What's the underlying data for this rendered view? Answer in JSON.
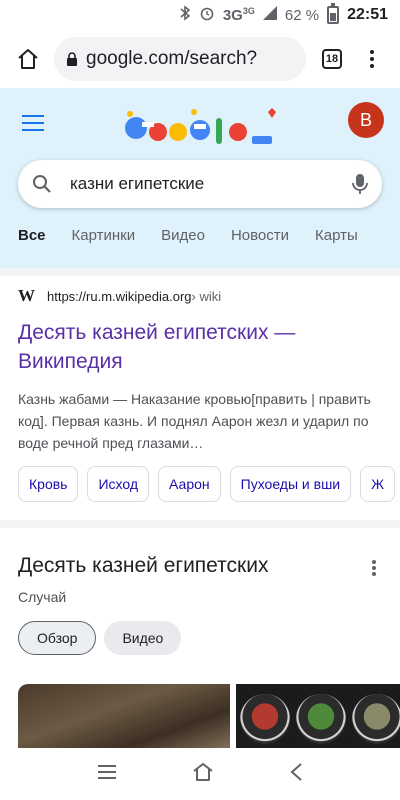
{
  "status_bar": {
    "network": "3G",
    "network_sup": "3G",
    "battery": "62 %",
    "time": "22:51"
  },
  "browser": {
    "url": "google.com/search?",
    "tab_count": "18"
  },
  "google": {
    "avatar_letter": "B",
    "search_query": "казни египетские",
    "tabs": [
      "Все",
      "Картинки",
      "Видео",
      "Новости",
      "Карты"
    ]
  },
  "result": {
    "site_url": "https://ru.m.wikipedia.org",
    "site_crumb": " › wiki",
    "title": "Десять казней египетских — Википедия",
    "snippet": "Казнь жабами — Наказание кровью[править | править код]. Первая казнь. И поднял Аарон жезл и ударил по воде речной пред глазами…",
    "chips": [
      "Кровь",
      "Исход",
      "Аарон",
      "Пухоеды и вши",
      "Ж"
    ]
  },
  "knowledge_panel": {
    "title": "Десять казней египетских",
    "subtitle": "Случай",
    "tabs": [
      "Обзор",
      "Видео"
    ]
  },
  "colors": {
    "header_bg": "#dff1fb",
    "link_visited": "#5b2fa8",
    "chip_link": "#1a0dab",
    "avatar_bg": "#c5341b",
    "accent": "#1a73e8"
  }
}
